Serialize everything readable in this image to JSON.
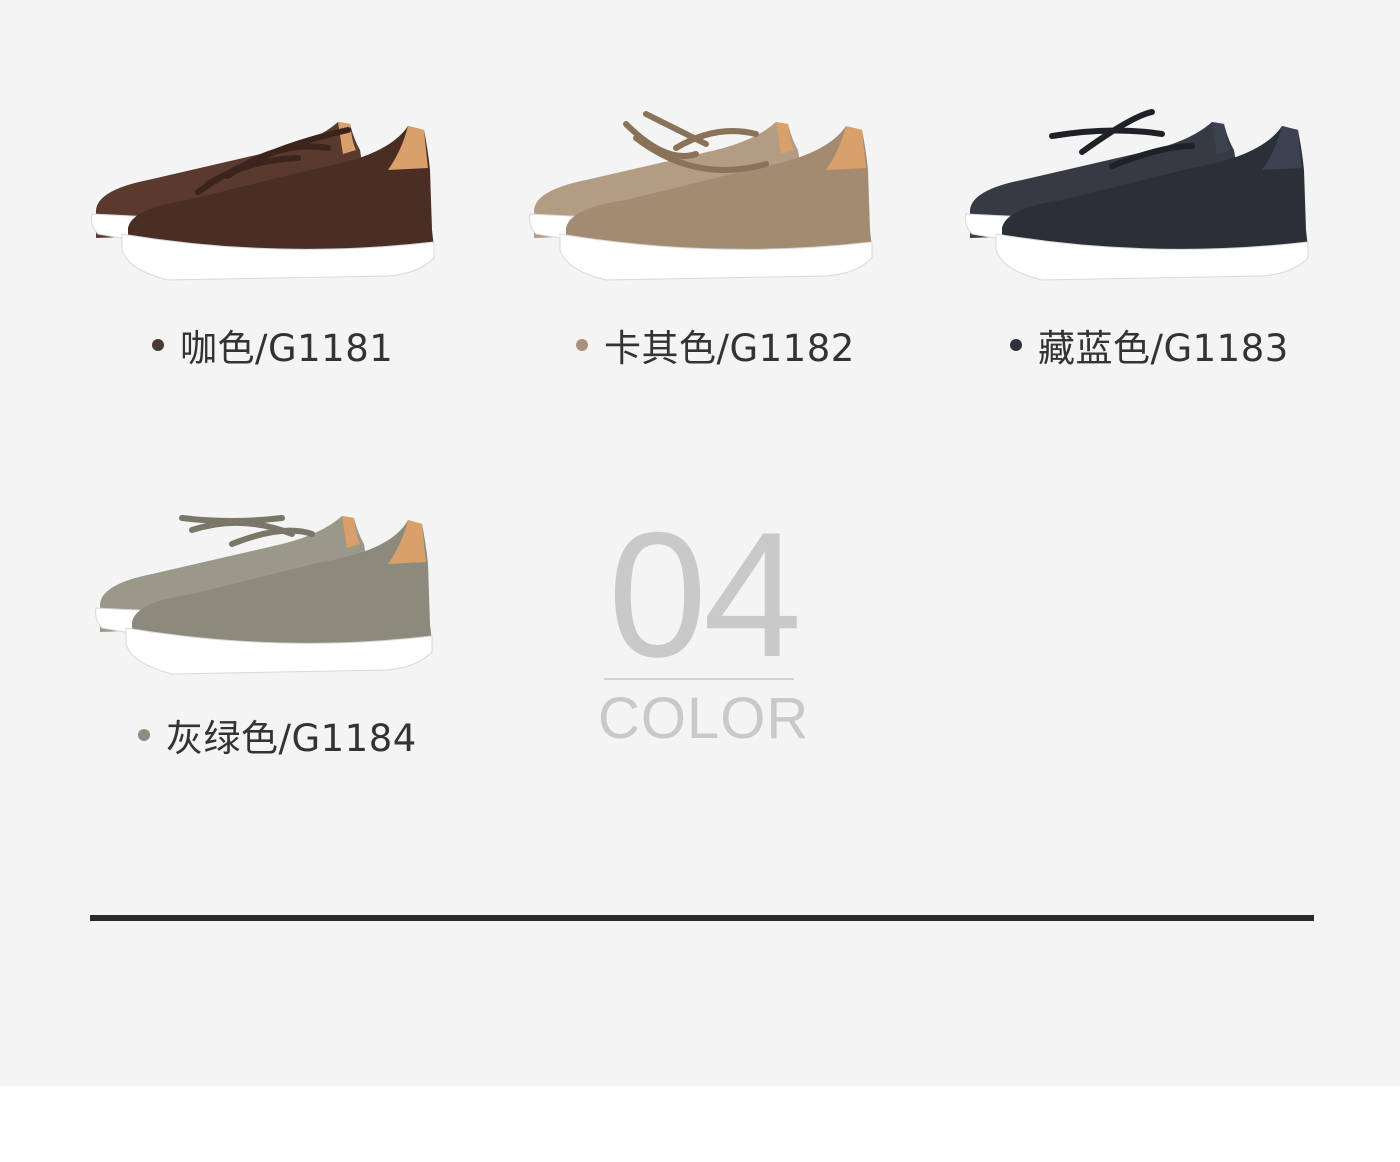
{
  "products": [
    {
      "label": "咖色/G1181",
      "upper_color": "#4a2e24",
      "dot_color": "#4a3a33",
      "lace_color": "#3b241c"
    },
    {
      "label": "卡其色/G1182",
      "upper_color": "#a38b72",
      "dot_color": "#a8907a",
      "lace_color": "#8a7258"
    },
    {
      "label": "藏蓝色/G1183",
      "upper_color": "#2a2f38",
      "dot_color": "#2e3238",
      "lace_color": "#1e2228"
    },
    {
      "label": "灰绿色/G1184",
      "upper_color": "#8c8a7c",
      "dot_color": "#8f8c80",
      "lace_color": "#7a7668"
    }
  ],
  "badge": {
    "number": "04",
    "word": "COLOR"
  },
  "colors": {
    "panel_bg": "#f4f4f4",
    "sole": "#ffffff",
    "lining": "#d9a06b",
    "divider": "#2a2a2a",
    "badge_text": "#c9c9c9"
  }
}
